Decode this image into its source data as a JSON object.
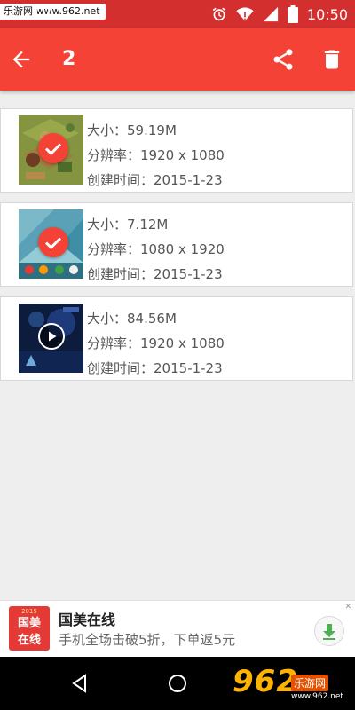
{
  "status_bar": {
    "watermark": "乐游网 www.962.net",
    "time": "10:50",
    "icons": [
      "alarm-icon",
      "wifi-icon",
      "cell-signal-icon",
      "battery-icon"
    ]
  },
  "toolbar": {
    "title": "2",
    "back_icon": "arrow-back-icon",
    "share_icon": "share-icon",
    "delete_icon": "delete-icon"
  },
  "files": [
    {
      "type": "image",
      "selected": true,
      "size_label": "大小：",
      "size": "59.19M",
      "resolution_label": "分辨率：",
      "resolution": "1920 x 1080",
      "created_label": "创建时间：",
      "created": "2015-1-23"
    },
    {
      "type": "image",
      "selected": true,
      "size_label": "大小：",
      "size": "7.12M",
      "resolution_label": "分辨率：",
      "resolution": "1080 x 1920",
      "created_label": "创建时间：",
      "created": "2015-1-23"
    },
    {
      "type": "video",
      "selected": false,
      "size_label": "大小：",
      "size": "84.56M",
      "resolution_label": "分辨率：",
      "resolution": "1920 x 1080",
      "created_label": "创建时间：",
      "created": "2015-1-23"
    }
  ],
  "ad": {
    "logo_year": "2015",
    "logo_text_1": "国美",
    "logo_text_2": "在线",
    "title": "国美在线",
    "subtitle": "手机全场击破5折，下单返5元",
    "close": "✕"
  },
  "nav": {
    "back_icon": "nav-back-icon",
    "home_icon": "nav-home-icon"
  },
  "watermark_br": {
    "big": "962",
    "small": "乐游网",
    "domain": "www.962.net"
  },
  "colors": {
    "status_bar": "#d32f2f",
    "toolbar": "#f44336",
    "accent": "#f44336"
  }
}
